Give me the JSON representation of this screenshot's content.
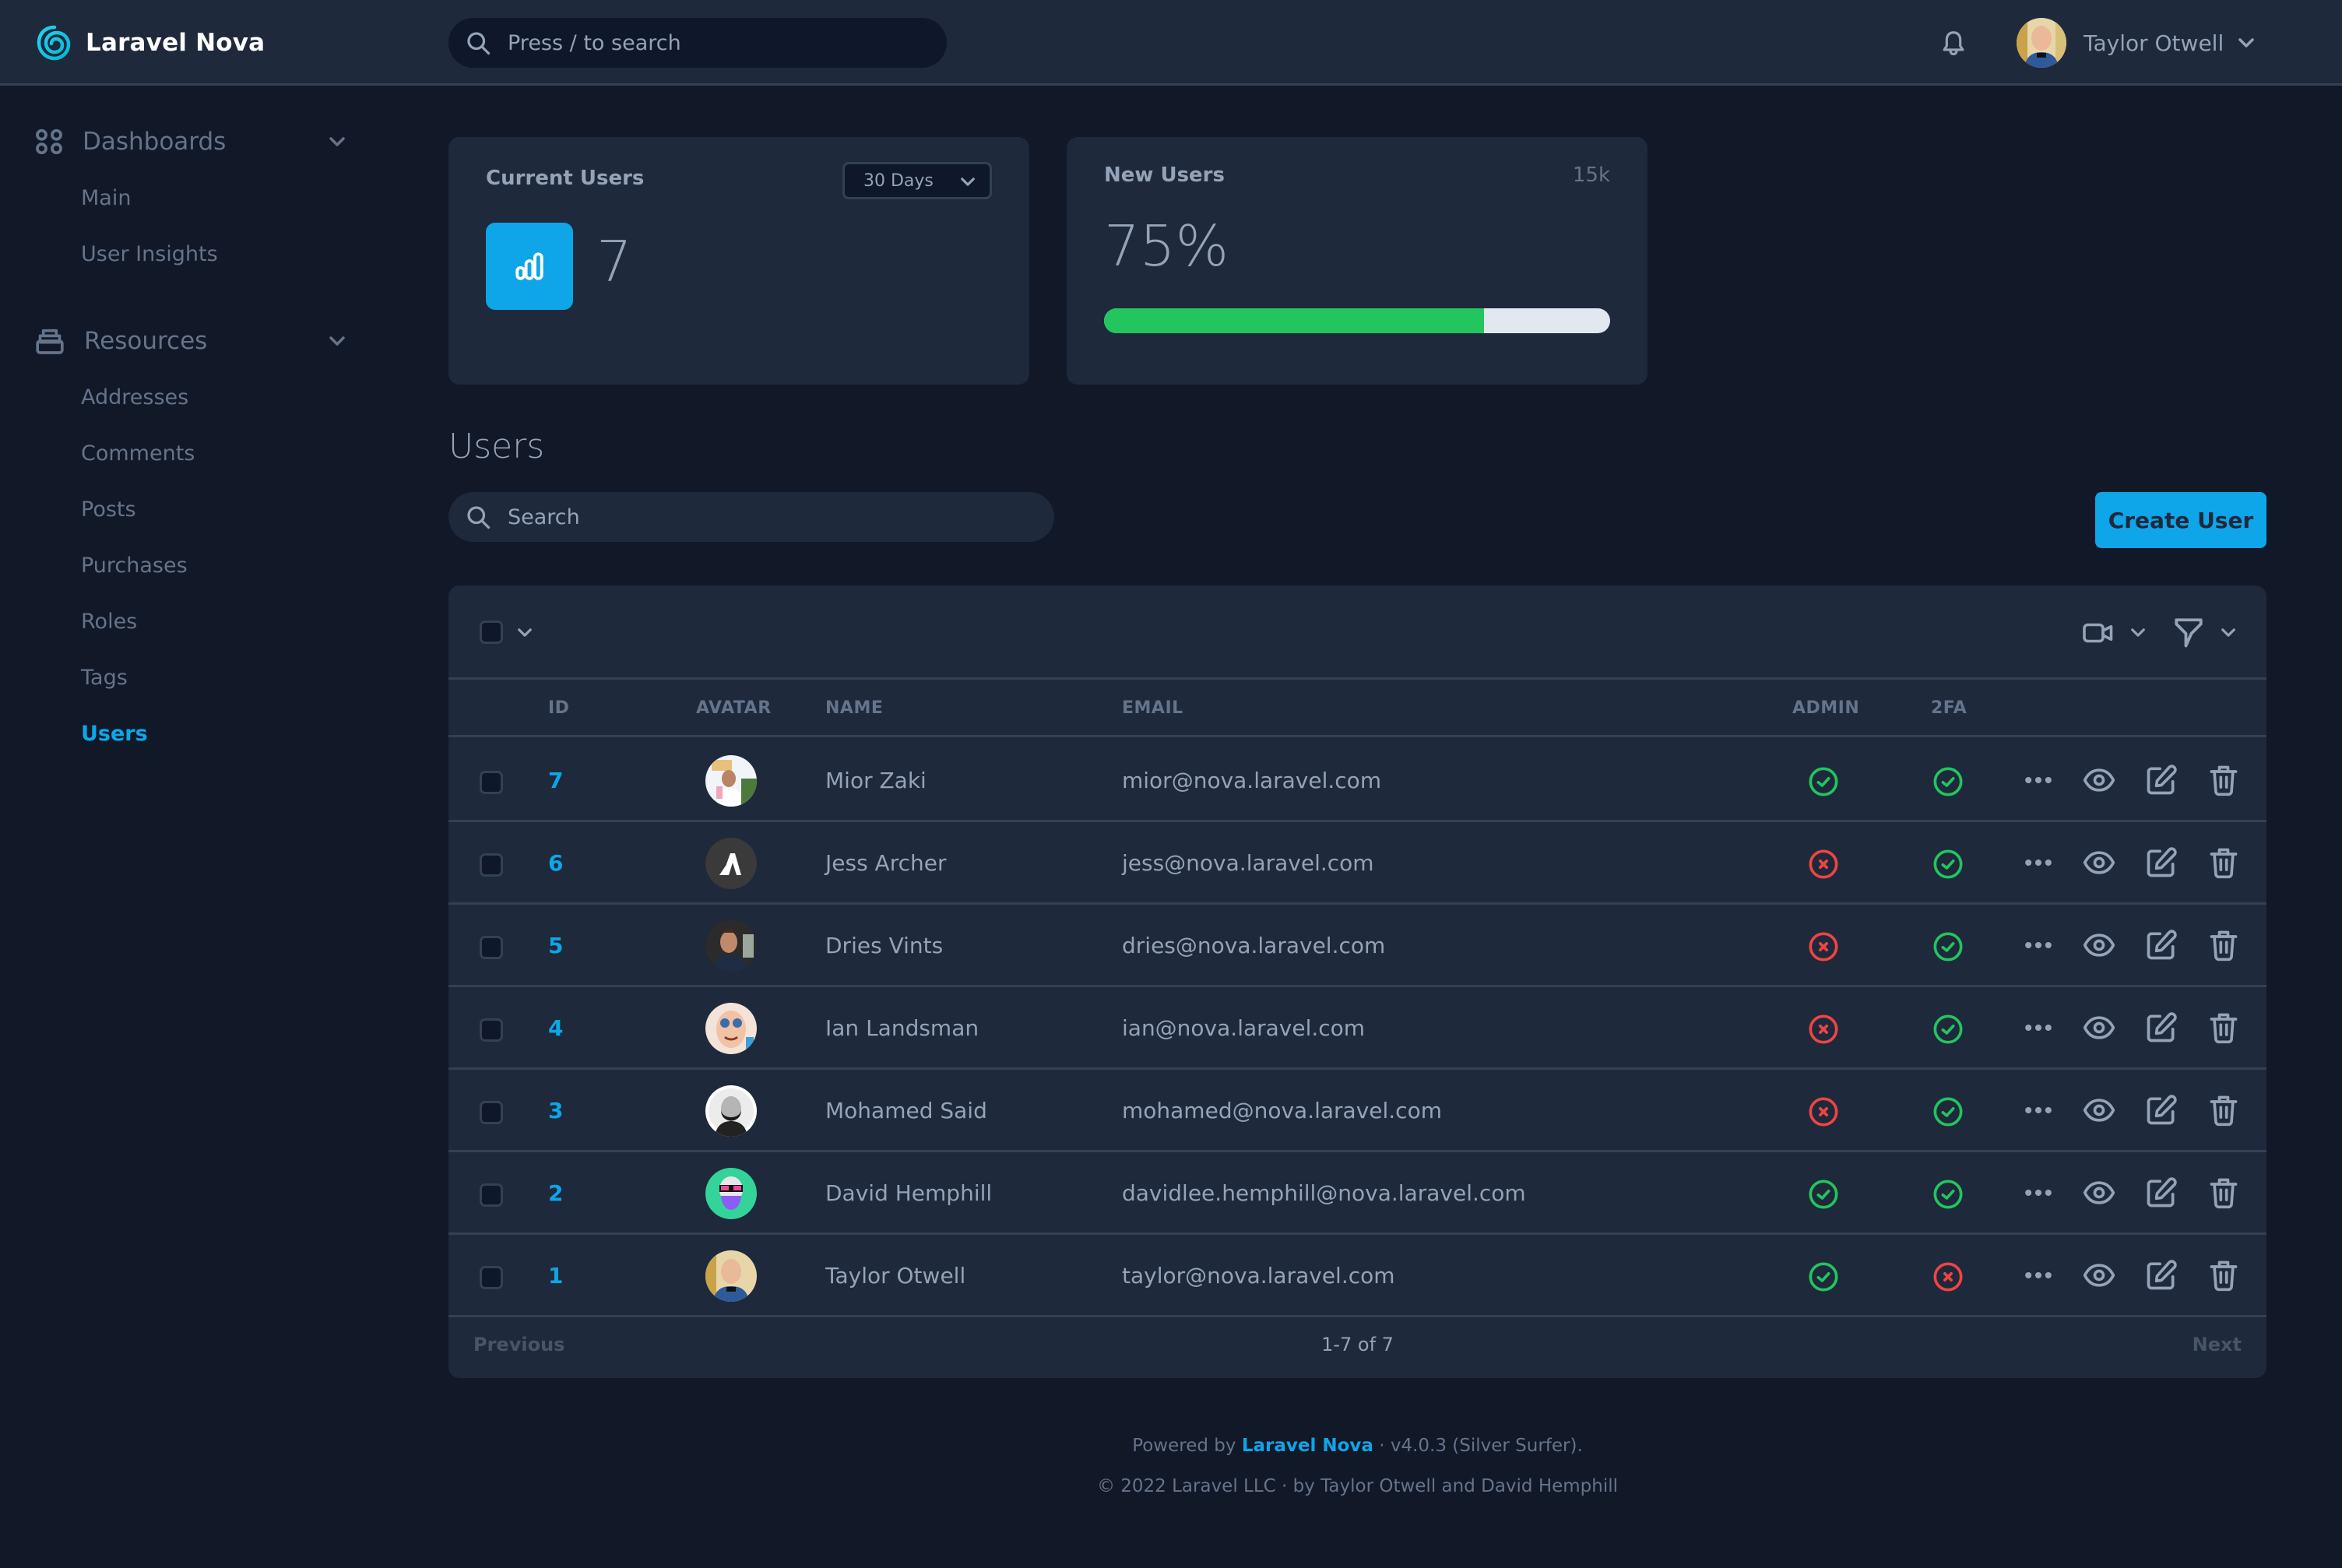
{
  "app": {
    "brand": "Laravel Nova",
    "accent_color": "#0ea5e9",
    "success_color": "#22c55e",
    "danger_color": "#ef4444"
  },
  "header": {
    "search_placeholder": "Press / to search",
    "notifications_icon": "bell-icon",
    "user_name": "Taylor Otwell"
  },
  "sidebar": {
    "sections": [
      {
        "label": "Dashboards",
        "icon": "grid-icon",
        "items": [
          {
            "label": "Main",
            "active": false
          },
          {
            "label": "User Insights",
            "active": false
          }
        ]
      },
      {
        "label": "Resources",
        "icon": "archive-icon",
        "items": [
          {
            "label": "Addresses",
            "active": false
          },
          {
            "label": "Comments",
            "active": false
          },
          {
            "label": "Posts",
            "active": false
          },
          {
            "label": "Purchases",
            "active": false
          },
          {
            "label": "Roles",
            "active": false
          },
          {
            "label": "Tags",
            "active": false
          },
          {
            "label": "Users",
            "active": true
          }
        ]
      }
    ]
  },
  "metrics": {
    "current_users": {
      "title": "Current Users",
      "range": "30 Days",
      "value": "7",
      "icon": "chart-bar-icon"
    },
    "new_users": {
      "title": "New Users",
      "target": "15k",
      "value": "75%",
      "progress_percent": 75
    }
  },
  "resource": {
    "title": "Users",
    "search_placeholder": "Search",
    "create_label": "Create User",
    "columns": [
      "ID",
      "AVATAR",
      "NAME",
      "EMAIL",
      "ADMIN",
      "2FA"
    ],
    "rows": [
      {
        "id": "7",
        "name": "Mior Zaki",
        "email": "mior@nova.laravel.com",
        "admin": true,
        "twofa": true
      },
      {
        "id": "6",
        "name": "Jess Archer",
        "email": "jess@nova.laravel.com",
        "admin": false,
        "twofa": true
      },
      {
        "id": "5",
        "name": "Dries Vints",
        "email": "dries@nova.laravel.com",
        "admin": false,
        "twofa": true
      },
      {
        "id": "4",
        "name": "Ian Landsman",
        "email": "ian@nova.laravel.com",
        "admin": false,
        "twofa": true
      },
      {
        "id": "3",
        "name": "Mohamed Said",
        "email": "mohamed@nova.laravel.com",
        "admin": false,
        "twofa": true
      },
      {
        "id": "2",
        "name": "David Hemphill",
        "email": "davidlee.hemphill@nova.laravel.com",
        "admin": true,
        "twofa": true
      },
      {
        "id": "1",
        "name": "Taylor Otwell",
        "email": "taylor@nova.laravel.com",
        "admin": true,
        "twofa": false
      }
    ],
    "pagination": {
      "previous": "Previous",
      "next": "Next",
      "count": "1-7 of 7"
    }
  },
  "footer": {
    "powered_prefix": "Powered by ",
    "powered_link": "Laravel Nova",
    "powered_suffix": " · v4.0.3 (Silver Surfer).",
    "copyright": "© 2022 Laravel LLC · by Taylor Otwell and David Hemphill"
  }
}
